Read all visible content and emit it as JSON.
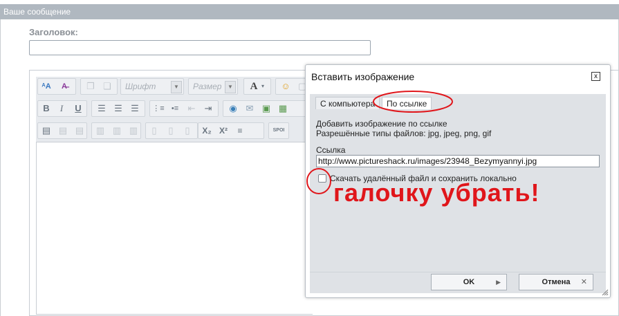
{
  "panel": {
    "title": "Ваше сообщение"
  },
  "form": {
    "title_label": "Заголовок:",
    "title_value": ""
  },
  "toolbar": {
    "font_combo": "Шрифт",
    "size_combo": "Размер"
  },
  "dialog": {
    "title": "Вставить изображение",
    "close_glyph": "x",
    "tabs": [
      {
        "label": "С компьютера"
      },
      {
        "label": "По ссылке"
      }
    ],
    "active_tab": "По ссылке",
    "desc_line1": "Добавить изображение по ссылке",
    "desc_line2": "Разрешённые типы файлов: jpg, jpeg, png, gif",
    "link_label": "Ссылка",
    "link_value": "http://www.pictureshack.ru/images/23948_Bezymyannyi.jpg",
    "checkbox_label": "Скачать удалённый файл и сохранить локально",
    "checkbox_checked": false,
    "ok_label": "OK",
    "cancel_label": "Отмена"
  },
  "annotation": {
    "text": "галочку убрать!",
    "color": "#e0161b"
  },
  "colors": {
    "header_bg": "#b0b8c0",
    "dialog_bg": "#dfe2e6",
    "toolbar_bg": "#e7eaee"
  }
}
